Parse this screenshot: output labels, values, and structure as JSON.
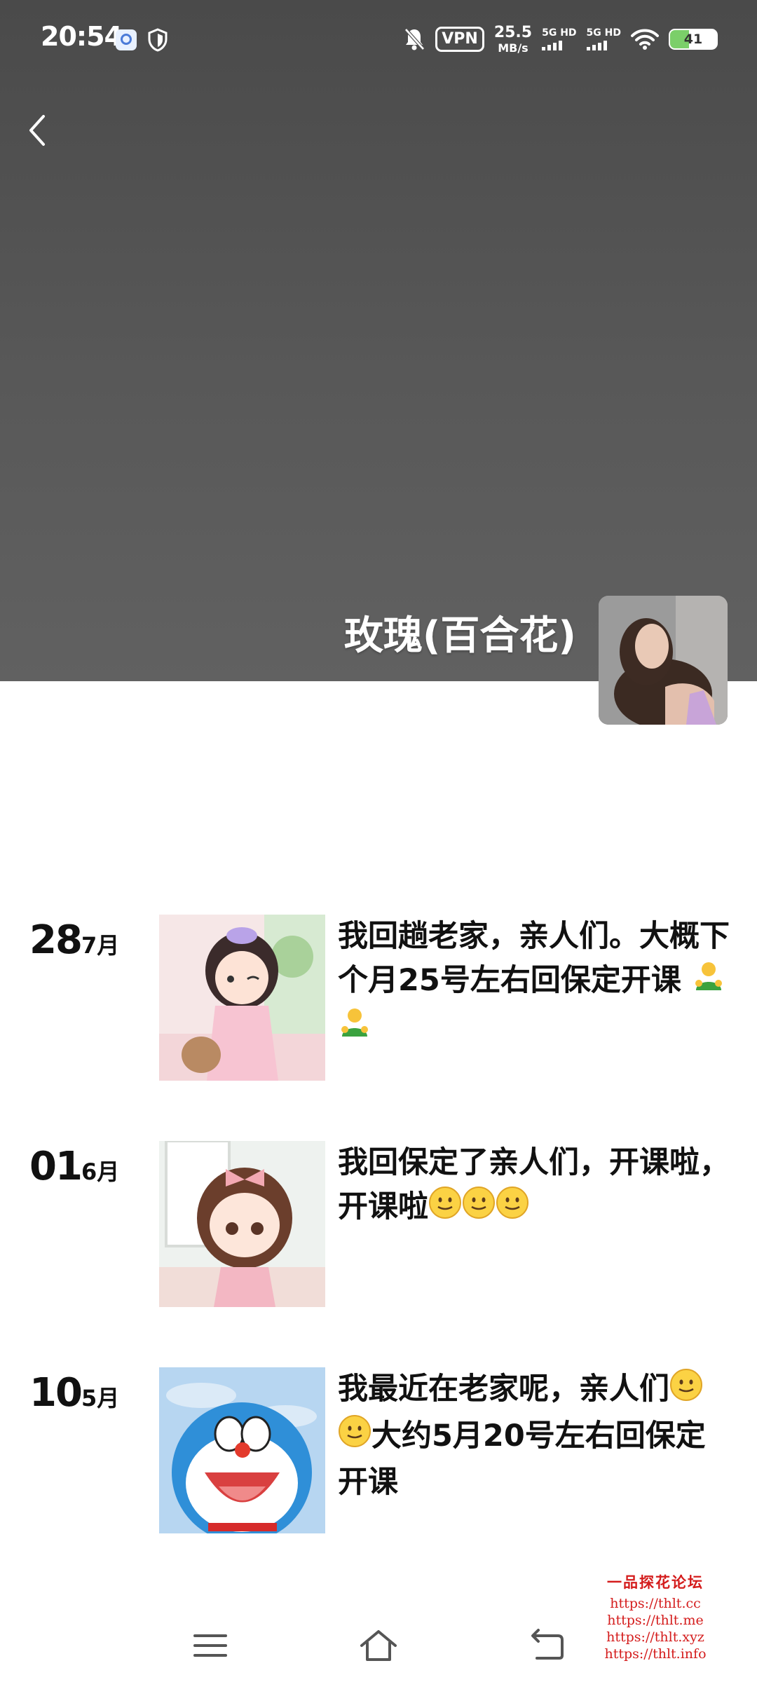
{
  "status_bar": {
    "time": "20:54",
    "vpn": "VPN",
    "speed_value": "25.5",
    "speed_unit": "MB/s",
    "sim1": "5G HD",
    "sim2": "5G HD",
    "battery": "41"
  },
  "profile": {
    "name": "玫瑰(百合花)"
  },
  "posts": [
    {
      "day": "28",
      "month": "7月",
      "text": "我回趟老家，亲人们。大概下个月25号左右回保定开课"
    },
    {
      "day": "01",
      "month": "6月",
      "text": "我回保定了亲人们，开课啦，开课啦"
    },
    {
      "day": "10",
      "month": "5月",
      "text_a": "我最近在老家呢，亲人们",
      "text_b": "大约5月20号左右回保定开课"
    }
  ],
  "watermark": {
    "title": "一品探花论坛",
    "lines": [
      "https://thlt.cc",
      "https://thlt.me",
      "https://thlt.xyz",
      "https://thlt.info"
    ]
  },
  "colors": {
    "cover": "#555555",
    "watermark": "#d41c1c"
  }
}
